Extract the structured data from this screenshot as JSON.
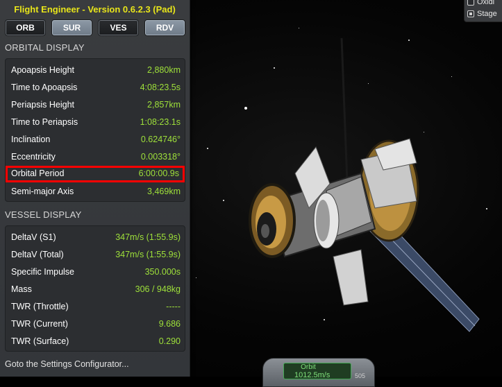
{
  "window_title": "Flight Engineer  -  Version 0.6.2.3 (Pad)",
  "tabs": [
    {
      "label": "ORB",
      "active": false
    },
    {
      "label": "SUR",
      "active": true
    },
    {
      "label": "VES",
      "active": false
    },
    {
      "label": "RDV",
      "active": true
    }
  ],
  "orbital": {
    "title": "ORBITAL DISPLAY",
    "rows": [
      {
        "label": "Apoapsis Height",
        "value": "2,880km"
      },
      {
        "label": "Time to Apoapsis",
        "value": "4:08:23.5s"
      },
      {
        "label": "Periapsis Height",
        "value": "2,857km"
      },
      {
        "label": "Time to Periapsis",
        "value": "1:08:23.1s"
      },
      {
        "label": "Inclination",
        "value": "0.624746°"
      },
      {
        "label": "Eccentricity",
        "value": "0.003318°"
      },
      {
        "label": "Orbital Period",
        "value": "6:00:00.9s",
        "highlighted": true
      },
      {
        "label": "Semi-major Axis",
        "value": "3,469km"
      }
    ]
  },
  "vessel": {
    "title": "VESSEL DISPLAY",
    "rows": [
      {
        "label": "DeltaV (S1)",
        "value": "347m/s (1:55.9s)"
      },
      {
        "label": "DeltaV (Total)",
        "value": "347m/s (1:55.9s)"
      },
      {
        "label": "Specific Impulse",
        "value": "350.000s"
      },
      {
        "label": "Mass",
        "value": "306 / 948kg"
      },
      {
        "label": "TWR (Throttle)",
        "value": "-----"
      },
      {
        "label": "TWR (Current)",
        "value": "9.686"
      },
      {
        "label": "TWR (Surface)",
        "value": "0.290"
      }
    ]
  },
  "settings_link": "Goto the Settings Configurator...",
  "toggles": [
    {
      "label": "Oxidi",
      "checked": false
    },
    {
      "label": "Stage",
      "checked": true
    }
  ],
  "orbit_widget": {
    "label": "Orbit",
    "speed": "1012.5m/s",
    "extra": "505"
  },
  "colors": {
    "title_yellow": "#e8e51a",
    "value_green": "#9ee03a",
    "highlight_red": "#ff0000"
  }
}
